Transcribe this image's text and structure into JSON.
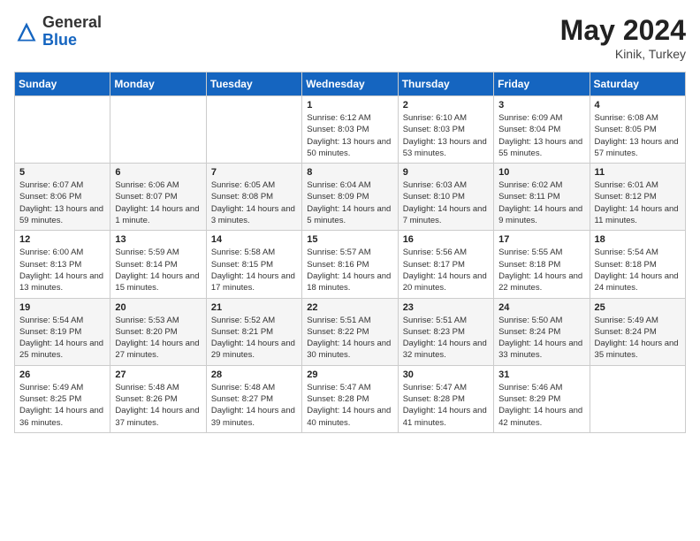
{
  "header": {
    "logo_general": "General",
    "logo_blue": "Blue",
    "month_year": "May 2024",
    "location": "Kinik, Turkey"
  },
  "days_of_week": [
    "Sunday",
    "Monday",
    "Tuesday",
    "Wednesday",
    "Thursday",
    "Friday",
    "Saturday"
  ],
  "weeks": [
    [
      {
        "day": "",
        "sunrise": "",
        "sunset": "",
        "daylight": ""
      },
      {
        "day": "",
        "sunrise": "",
        "sunset": "",
        "daylight": ""
      },
      {
        "day": "",
        "sunrise": "",
        "sunset": "",
        "daylight": ""
      },
      {
        "day": "1",
        "sunrise": "Sunrise: 6:12 AM",
        "sunset": "Sunset: 8:03 PM",
        "daylight": "Daylight: 13 hours and 50 minutes."
      },
      {
        "day": "2",
        "sunrise": "Sunrise: 6:10 AM",
        "sunset": "Sunset: 8:03 PM",
        "daylight": "Daylight: 13 hours and 53 minutes."
      },
      {
        "day": "3",
        "sunrise": "Sunrise: 6:09 AM",
        "sunset": "Sunset: 8:04 PM",
        "daylight": "Daylight: 13 hours and 55 minutes."
      },
      {
        "day": "4",
        "sunrise": "Sunrise: 6:08 AM",
        "sunset": "Sunset: 8:05 PM",
        "daylight": "Daylight: 13 hours and 57 minutes."
      }
    ],
    [
      {
        "day": "5",
        "sunrise": "Sunrise: 6:07 AM",
        "sunset": "Sunset: 8:06 PM",
        "daylight": "Daylight: 13 hours and 59 minutes."
      },
      {
        "day": "6",
        "sunrise": "Sunrise: 6:06 AM",
        "sunset": "Sunset: 8:07 PM",
        "daylight": "Daylight: 14 hours and 1 minute."
      },
      {
        "day": "7",
        "sunrise": "Sunrise: 6:05 AM",
        "sunset": "Sunset: 8:08 PM",
        "daylight": "Daylight: 14 hours and 3 minutes."
      },
      {
        "day": "8",
        "sunrise": "Sunrise: 6:04 AM",
        "sunset": "Sunset: 8:09 PM",
        "daylight": "Daylight: 14 hours and 5 minutes."
      },
      {
        "day": "9",
        "sunrise": "Sunrise: 6:03 AM",
        "sunset": "Sunset: 8:10 PM",
        "daylight": "Daylight: 14 hours and 7 minutes."
      },
      {
        "day": "10",
        "sunrise": "Sunrise: 6:02 AM",
        "sunset": "Sunset: 8:11 PM",
        "daylight": "Daylight: 14 hours and 9 minutes."
      },
      {
        "day": "11",
        "sunrise": "Sunrise: 6:01 AM",
        "sunset": "Sunset: 8:12 PM",
        "daylight": "Daylight: 14 hours and 11 minutes."
      }
    ],
    [
      {
        "day": "12",
        "sunrise": "Sunrise: 6:00 AM",
        "sunset": "Sunset: 8:13 PM",
        "daylight": "Daylight: 14 hours and 13 minutes."
      },
      {
        "day": "13",
        "sunrise": "Sunrise: 5:59 AM",
        "sunset": "Sunset: 8:14 PM",
        "daylight": "Daylight: 14 hours and 15 minutes."
      },
      {
        "day": "14",
        "sunrise": "Sunrise: 5:58 AM",
        "sunset": "Sunset: 8:15 PM",
        "daylight": "Daylight: 14 hours and 17 minutes."
      },
      {
        "day": "15",
        "sunrise": "Sunrise: 5:57 AM",
        "sunset": "Sunset: 8:16 PM",
        "daylight": "Daylight: 14 hours and 18 minutes."
      },
      {
        "day": "16",
        "sunrise": "Sunrise: 5:56 AM",
        "sunset": "Sunset: 8:17 PM",
        "daylight": "Daylight: 14 hours and 20 minutes."
      },
      {
        "day": "17",
        "sunrise": "Sunrise: 5:55 AM",
        "sunset": "Sunset: 8:18 PM",
        "daylight": "Daylight: 14 hours and 22 minutes."
      },
      {
        "day": "18",
        "sunrise": "Sunrise: 5:54 AM",
        "sunset": "Sunset: 8:18 PM",
        "daylight": "Daylight: 14 hours and 24 minutes."
      }
    ],
    [
      {
        "day": "19",
        "sunrise": "Sunrise: 5:54 AM",
        "sunset": "Sunset: 8:19 PM",
        "daylight": "Daylight: 14 hours and 25 minutes."
      },
      {
        "day": "20",
        "sunrise": "Sunrise: 5:53 AM",
        "sunset": "Sunset: 8:20 PM",
        "daylight": "Daylight: 14 hours and 27 minutes."
      },
      {
        "day": "21",
        "sunrise": "Sunrise: 5:52 AM",
        "sunset": "Sunset: 8:21 PM",
        "daylight": "Daylight: 14 hours and 29 minutes."
      },
      {
        "day": "22",
        "sunrise": "Sunrise: 5:51 AM",
        "sunset": "Sunset: 8:22 PM",
        "daylight": "Daylight: 14 hours and 30 minutes."
      },
      {
        "day": "23",
        "sunrise": "Sunrise: 5:51 AM",
        "sunset": "Sunset: 8:23 PM",
        "daylight": "Daylight: 14 hours and 32 minutes."
      },
      {
        "day": "24",
        "sunrise": "Sunrise: 5:50 AM",
        "sunset": "Sunset: 8:24 PM",
        "daylight": "Daylight: 14 hours and 33 minutes."
      },
      {
        "day": "25",
        "sunrise": "Sunrise: 5:49 AM",
        "sunset": "Sunset: 8:24 PM",
        "daylight": "Daylight: 14 hours and 35 minutes."
      }
    ],
    [
      {
        "day": "26",
        "sunrise": "Sunrise: 5:49 AM",
        "sunset": "Sunset: 8:25 PM",
        "daylight": "Daylight: 14 hours and 36 minutes."
      },
      {
        "day": "27",
        "sunrise": "Sunrise: 5:48 AM",
        "sunset": "Sunset: 8:26 PM",
        "daylight": "Daylight: 14 hours and 37 minutes."
      },
      {
        "day": "28",
        "sunrise": "Sunrise: 5:48 AM",
        "sunset": "Sunset: 8:27 PM",
        "daylight": "Daylight: 14 hours and 39 minutes."
      },
      {
        "day": "29",
        "sunrise": "Sunrise: 5:47 AM",
        "sunset": "Sunset: 8:28 PM",
        "daylight": "Daylight: 14 hours and 40 minutes."
      },
      {
        "day": "30",
        "sunrise": "Sunrise: 5:47 AM",
        "sunset": "Sunset: 8:28 PM",
        "daylight": "Daylight: 14 hours and 41 minutes."
      },
      {
        "day": "31",
        "sunrise": "Sunrise: 5:46 AM",
        "sunset": "Sunset: 8:29 PM",
        "daylight": "Daylight: 14 hours and 42 minutes."
      },
      {
        "day": "",
        "sunrise": "",
        "sunset": "",
        "daylight": ""
      }
    ]
  ]
}
